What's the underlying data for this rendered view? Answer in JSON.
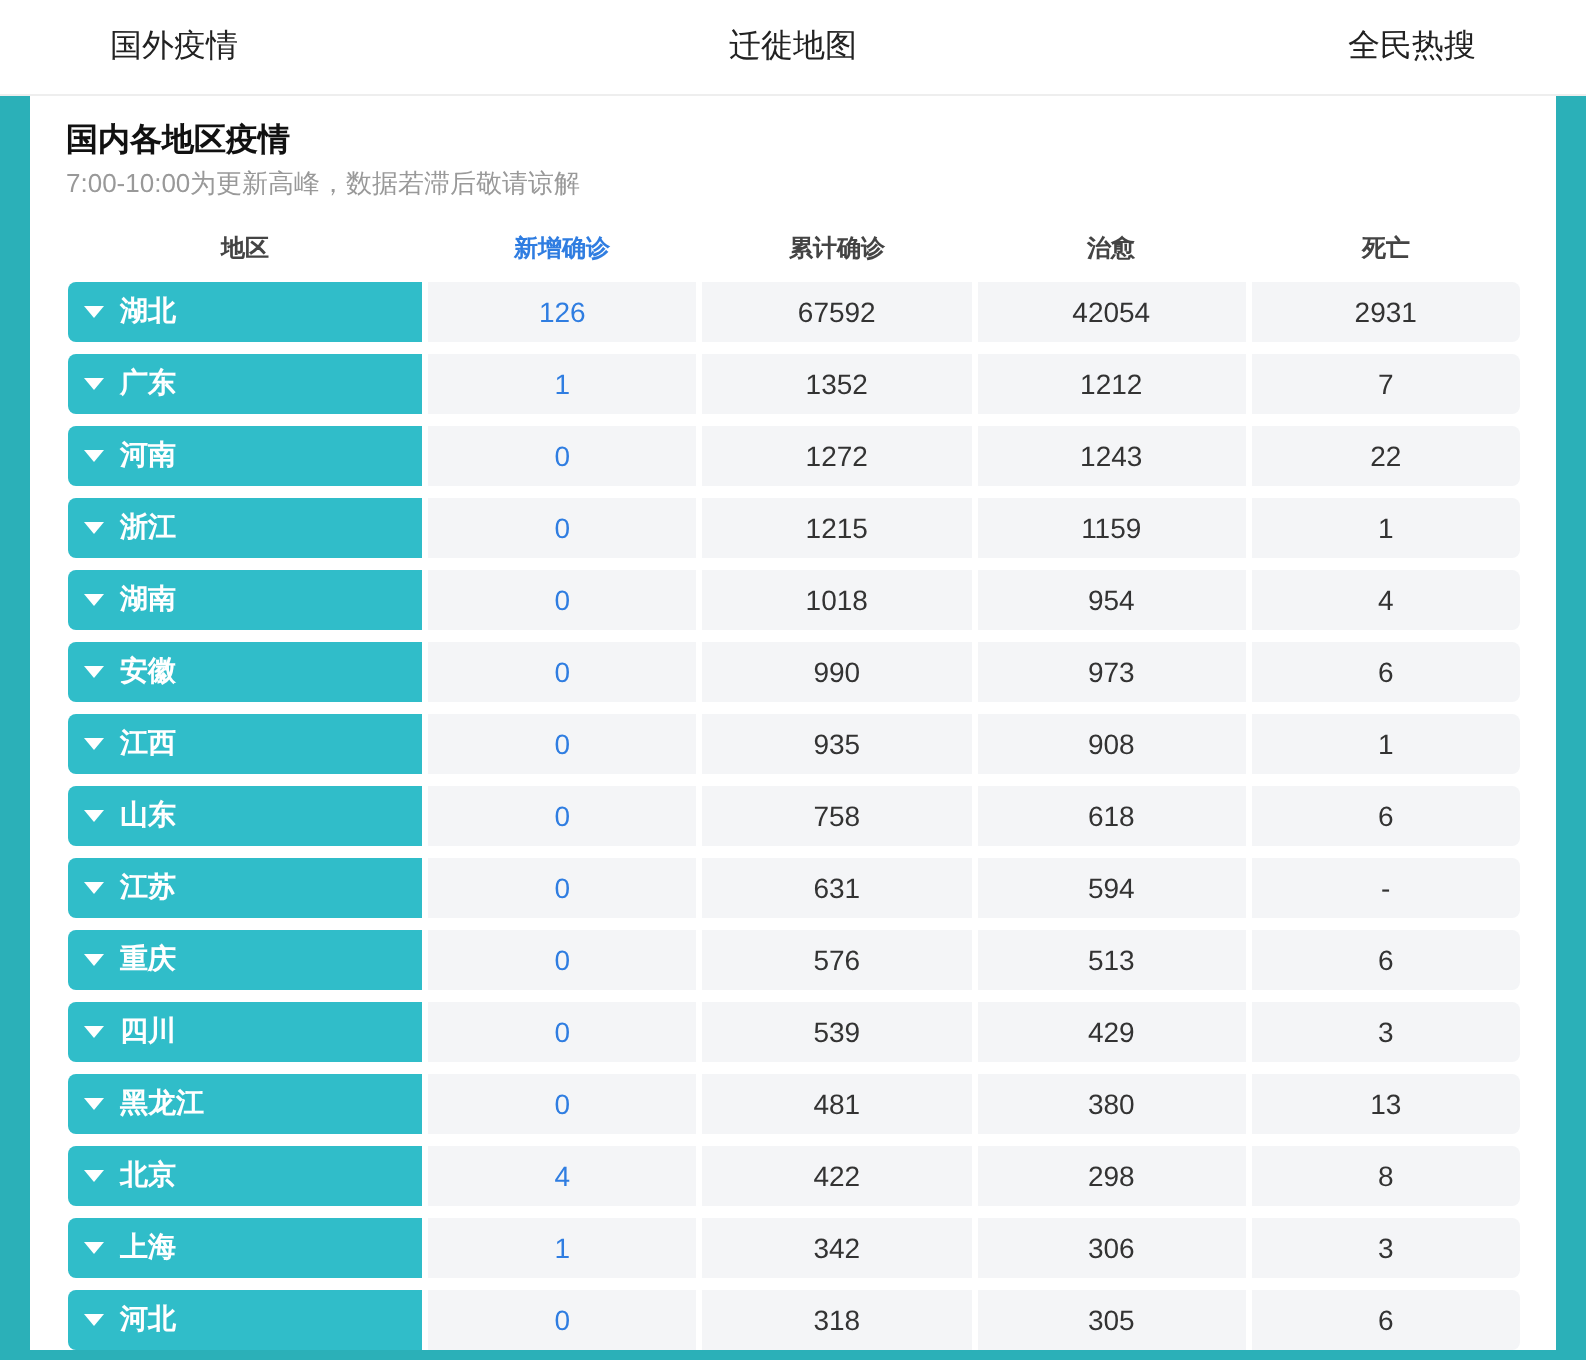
{
  "nav": {
    "tabs": [
      {
        "label": "国外疫情"
      },
      {
        "label": "迁徙地图"
      },
      {
        "label": "全民热搜"
      }
    ]
  },
  "panel": {
    "title": "国内各地区疫情",
    "subtitle": "7:00-10:00为更新高峰，数据若滞后敬请谅解"
  },
  "table": {
    "columns": [
      {
        "label": "地区",
        "highlight": false
      },
      {
        "label": "新增确诊",
        "highlight": true
      },
      {
        "label": "累计确诊",
        "highlight": false
      },
      {
        "label": "治愈",
        "highlight": false
      },
      {
        "label": "死亡",
        "highlight": false
      }
    ],
    "rows": [
      {
        "region": "湖北",
        "new": "126",
        "total": "67592",
        "cured": "42054",
        "dead": "2931",
        "expanded": false
      },
      {
        "region": "广东",
        "new": "1",
        "total": "1352",
        "cured": "1212",
        "dead": "7",
        "expanded": false
      },
      {
        "region": "河南",
        "new": "0",
        "total": "1272",
        "cured": "1243",
        "dead": "22",
        "expanded": false
      },
      {
        "region": "浙江",
        "new": "0",
        "total": "1215",
        "cured": "1159",
        "dead": "1",
        "expanded": false
      },
      {
        "region": "湖南",
        "new": "0",
        "total": "1018",
        "cured": "954",
        "dead": "4",
        "expanded": false
      },
      {
        "region": "安徽",
        "new": "0",
        "total": "990",
        "cured": "973",
        "dead": "6",
        "expanded": false
      },
      {
        "region": "江西",
        "new": "0",
        "total": "935",
        "cured": "908",
        "dead": "1",
        "expanded": false
      },
      {
        "region": "山东",
        "new": "0",
        "total": "758",
        "cured": "618",
        "dead": "6",
        "expanded": false
      },
      {
        "region": "江苏",
        "new": "0",
        "total": "631",
        "cured": "594",
        "dead": "-",
        "expanded": false
      },
      {
        "region": "重庆",
        "new": "0",
        "total": "576",
        "cured": "513",
        "dead": "6",
        "expanded": false
      },
      {
        "region": "四川",
        "new": "0",
        "total": "539",
        "cured": "429",
        "dead": "3",
        "expanded": false
      },
      {
        "region": "黑龙江",
        "new": "0",
        "total": "481",
        "cured": "380",
        "dead": "13",
        "expanded": false
      },
      {
        "region": "北京",
        "new": "4",
        "total": "422",
        "cured": "298",
        "dead": "8",
        "expanded": false
      },
      {
        "region": "上海",
        "new": "1",
        "total": "342",
        "cured": "306",
        "dead": "3",
        "expanded": false
      },
      {
        "region": "河北",
        "new": "0",
        "total": "318",
        "cured": "305",
        "dead": "6",
        "expanded": false
      }
    ]
  }
}
